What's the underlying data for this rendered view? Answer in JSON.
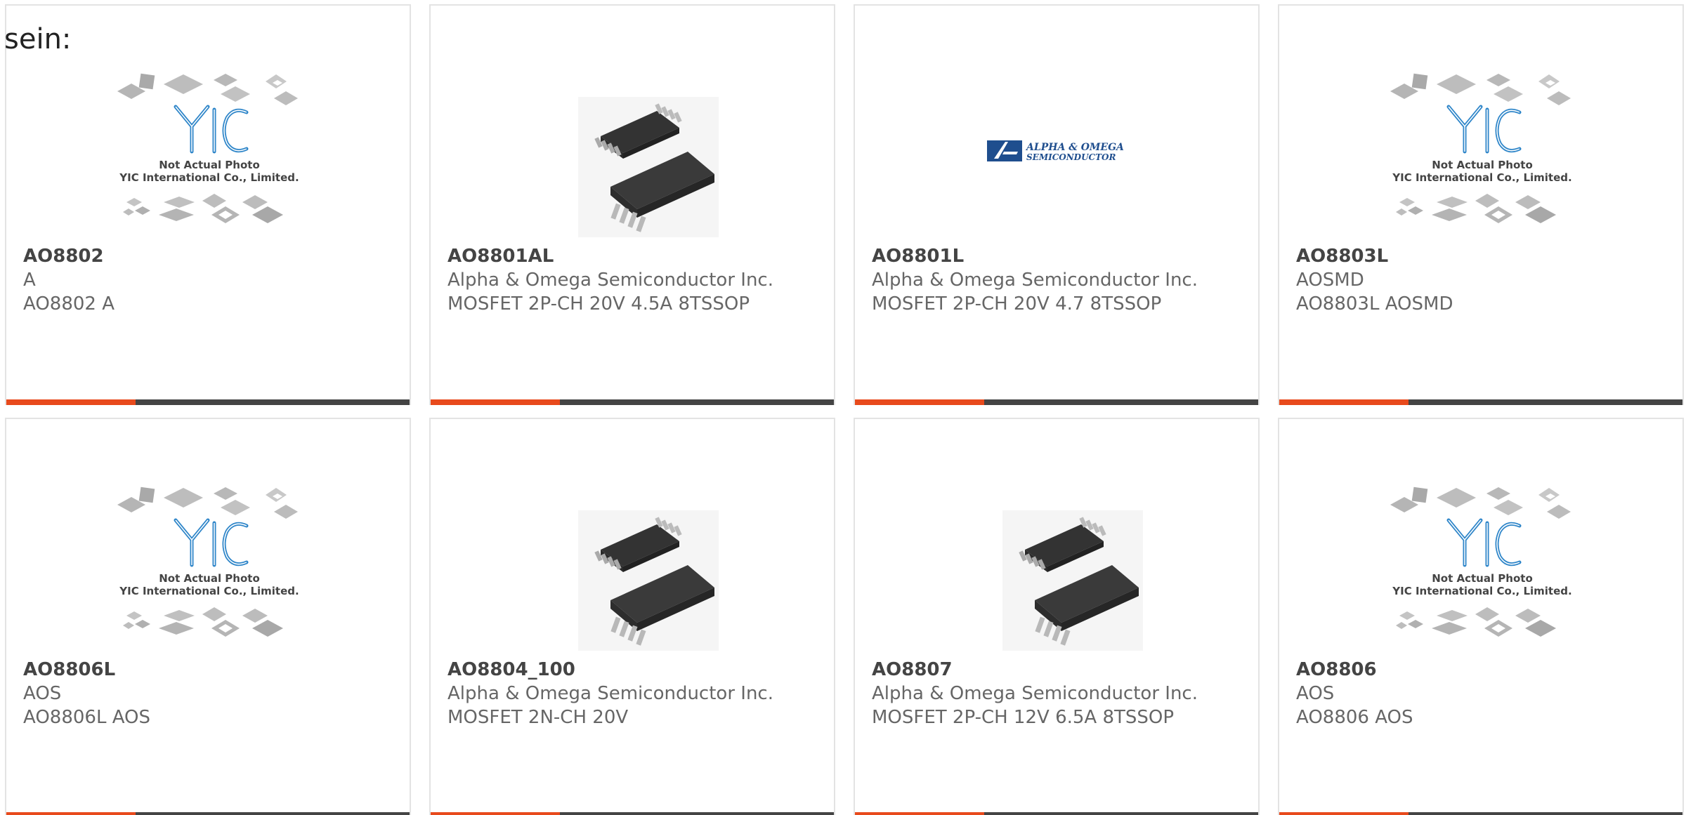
{
  "intro_text": "sein:",
  "placeholder": {
    "caption_line1": "Not Actual Photo",
    "caption_line2": "YIC International Co., Limited.",
    "logo_text": "YIC"
  },
  "aos_logo": {
    "line1": "ALPHA & OMEGA",
    "line2": "SEMICONDUCTOR"
  },
  "colors": {
    "accent_bar": "#e84a1c",
    "dark_bar": "#444444",
    "yic_blue": "#2f86c9",
    "aos_blue": "#1f4e8e"
  },
  "products": [
    {
      "part": "AO8802",
      "maker": "A",
      "desc": "AO8802 A",
      "image": "yic-placeholder"
    },
    {
      "part": "AO8801AL",
      "maker": "Alpha & Omega Semiconductor Inc.",
      "desc": "MOSFET 2P-CH 20V 4.5A 8TSSOP",
      "image": "tssop-chip"
    },
    {
      "part": "AO8801L",
      "maker": "Alpha & Omega Semiconductor Inc.",
      "desc": "MOSFET 2P-CH 20V 4.7 8TSSOP",
      "image": "aos-logo"
    },
    {
      "part": "AO8803L",
      "maker": "AOSMD",
      "desc": "AO8803L AOSMD",
      "image": "yic-placeholder"
    },
    {
      "part": "AO8806L",
      "maker": "AOS",
      "desc": "AO8806L AOS",
      "image": "yic-placeholder"
    },
    {
      "part": "AO8804_100",
      "maker": "Alpha & Omega Semiconductor Inc.",
      "desc": "MOSFET 2N-CH 20V",
      "image": "tssop-chip"
    },
    {
      "part": "AO8807",
      "maker": "Alpha & Omega Semiconductor Inc.",
      "desc": "MOSFET 2P-CH 12V 6.5A 8TSSOP",
      "image": "tssop-chip"
    },
    {
      "part": "AO8806",
      "maker": "AOS",
      "desc": "AO8806 AOS",
      "image": "yic-placeholder"
    }
  ]
}
